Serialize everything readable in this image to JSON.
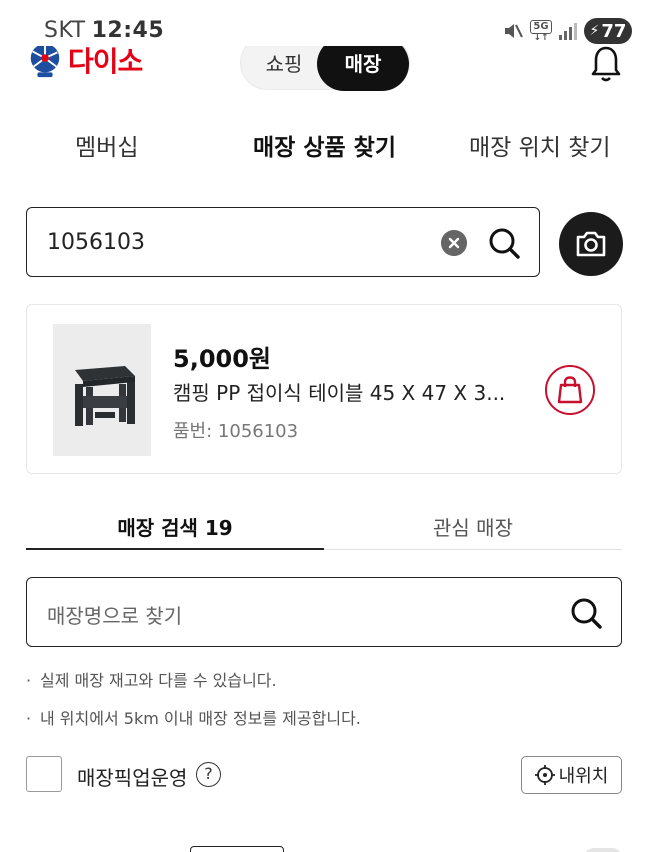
{
  "status_bar": {
    "carrier": "SKT",
    "time": "12:45",
    "network": "5G",
    "battery": "77"
  },
  "header": {
    "logo_text": "다이소",
    "mode_toggle": {
      "shopping": "쇼핑",
      "store": "매장",
      "active": "store"
    }
  },
  "top_tabs": [
    {
      "label": "멤버십",
      "active": false
    },
    {
      "label": "매장 상품 찾기",
      "active": true
    },
    {
      "label": "매장 위치 찾기",
      "active": false
    }
  ],
  "search": {
    "value": "1056103"
  },
  "product": {
    "price": "5,000원",
    "name": "캠핑 PP 접이식 테이블 45 X 47 X 3...",
    "code_label": "품번:",
    "code": "1056103"
  },
  "store_tabs": [
    {
      "label": "매장 검색 19",
      "active": true
    },
    {
      "label": "관심 매장",
      "active": false
    }
  ],
  "store_search": {
    "placeholder": "매장명으로 찾기"
  },
  "notices": [
    "실제 매장 재고와 다를 수 있습니다.",
    "내 위치에서 5km 이내 매장 정보를 제공합니다."
  ],
  "pickup": {
    "label": "매장픽업운영",
    "help": "?",
    "my_location_label": "내위치",
    "checked": false
  },
  "colors": {
    "brand_red": "#e50014",
    "dark": "#111111",
    "bag_red": "#c8102e"
  }
}
